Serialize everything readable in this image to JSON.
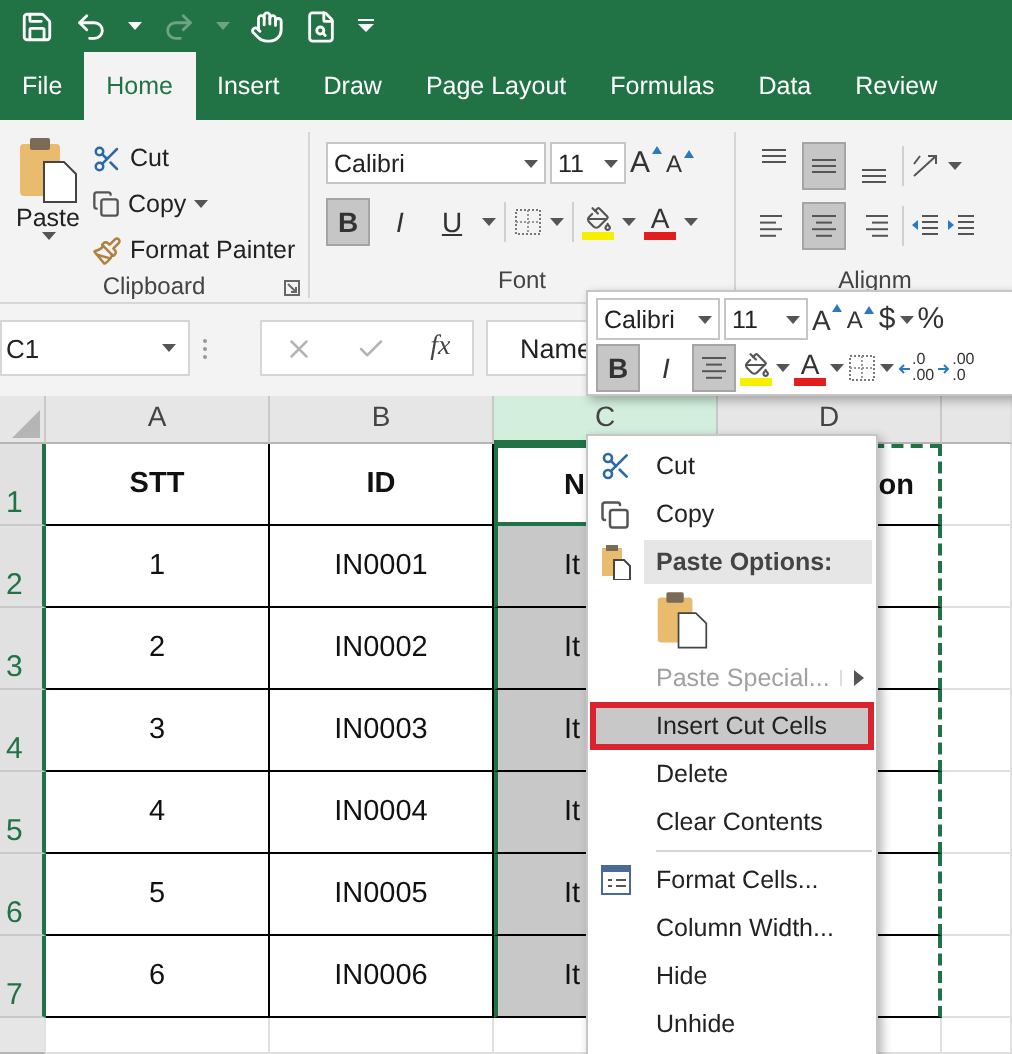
{
  "tabs": [
    {
      "label": "File",
      "selected": false
    },
    {
      "label": "Home",
      "selected": true
    },
    {
      "label": "Insert",
      "selected": false
    },
    {
      "label": "Draw",
      "selected": false
    },
    {
      "label": "Page Layout",
      "selected": false
    },
    {
      "label": "Formulas",
      "selected": false
    },
    {
      "label": "Data",
      "selected": false
    },
    {
      "label": "Review",
      "selected": false
    }
  ],
  "clipboard": {
    "paste": "Paste",
    "cut": "Cut",
    "copy": "Copy",
    "format_painter": "Format Painter",
    "label": "Clipboard"
  },
  "font": {
    "name": "Calibri",
    "size": "11",
    "grow": "A",
    "shrink": "A",
    "font_color": "A",
    "label": "Font",
    "styles": [
      {
        "label": "B",
        "pressed": true
      },
      {
        "label": "I",
        "pressed": false
      },
      {
        "label": "U",
        "pressed": false
      }
    ]
  },
  "alignment": {
    "label": "Alignm",
    "vertical": [
      {
        "pressed": false
      },
      {
        "pressed": true
      },
      {
        "pressed": false
      }
    ],
    "horizontal": [
      {
        "pressed": false
      },
      {
        "pressed": true
      },
      {
        "pressed": false
      }
    ]
  },
  "formula_bar": {
    "name_box": "C1",
    "fx": "fx",
    "content": "Name"
  },
  "columns": [
    {
      "label": "A",
      "selected": false,
      "cut": false
    },
    {
      "label": "B",
      "selected": false,
      "cut": false
    },
    {
      "label": "C",
      "selected": true,
      "cut": false
    },
    {
      "label": "D",
      "selected": false,
      "cut": true
    }
  ],
  "rows": [
    {
      "number": "1",
      "bold": true,
      "active": true,
      "cells": [
        "STT",
        "ID",
        "N",
        "on"
      ]
    },
    {
      "number": "2",
      "bold": false,
      "active": false,
      "cells": [
        "1",
        "IN0001",
        "It",
        null
      ]
    },
    {
      "number": "3",
      "bold": false,
      "active": false,
      "cells": [
        "2",
        "IN0002",
        "It",
        null
      ]
    },
    {
      "number": "4",
      "bold": false,
      "active": false,
      "cells": [
        "3",
        "IN0003",
        "It",
        null
      ]
    },
    {
      "number": "5",
      "bold": false,
      "active": false,
      "cells": [
        "4",
        "IN0004",
        "It",
        null
      ]
    },
    {
      "number": "6",
      "bold": false,
      "active": false,
      "cells": [
        "5",
        "IN0005",
        "It",
        null
      ]
    },
    {
      "number": "7",
      "bold": false,
      "active": false,
      "cells": [
        "6",
        "IN0006",
        "It",
        null
      ]
    }
  ],
  "mini_toolbar": {
    "font": "Calibri",
    "size": "11",
    "grow": "A",
    "shrink": "A",
    "currency": "$",
    "percent": "%",
    "font_color": "A",
    "center_pressed": true,
    "styles": [
      {
        "label": "B",
        "pressed": true
      },
      {
        "label": "I",
        "pressed": false
      }
    ],
    "decimals": [
      {
        "top": ".0",
        "bottom": ".00"
      },
      {
        "top": ".00",
        "bottom": ".0"
      }
    ]
  },
  "context_menu": {
    "sections": [
      [
        {
          "kind": "cut",
          "label": "Cut",
          "selected": false,
          "disabled": false
        },
        {
          "kind": "copy",
          "label": "Copy",
          "selected": false,
          "disabled": false
        },
        {
          "kind": "header",
          "label": "Paste Options:"
        },
        {
          "kind": "paste",
          "selected": false
        },
        {
          "kind": "submenu",
          "label": "Paste Special...",
          "selected": false,
          "disabled": true
        },
        {
          "kind": "plain",
          "label": "Insert Cut Cells",
          "selected": true,
          "disabled": false
        },
        {
          "kind": "plain",
          "label": "Delete",
          "selected": false,
          "disabled": false
        },
        {
          "kind": "plain",
          "label": "Clear Contents",
          "selected": false,
          "disabled": false
        }
      ],
      [
        {
          "kind": "format",
          "label": "Format Cells...",
          "selected": false,
          "disabled": false
        },
        {
          "kind": "plain",
          "label": "Column Width...",
          "selected": false,
          "disabled": false
        },
        {
          "kind": "plain",
          "label": "Hide",
          "selected": false,
          "disabled": false
        },
        {
          "kind": "plain",
          "label": "Unhide",
          "selected": false,
          "disabled": false
        }
      ]
    ]
  }
}
